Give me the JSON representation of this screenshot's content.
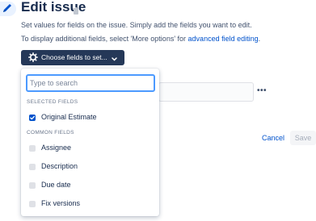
{
  "header": {
    "title": "Edit issue",
    "description": "Set values for fields on the issue. Simply add the fields you want to edit.",
    "more_text": "To display additional fields, select 'More options' for ",
    "more_link": "advanced field editing",
    "more_suffix": "."
  },
  "toolbar": {
    "choose_fields_label": "Choose fields to set..."
  },
  "dropdown": {
    "search_placeholder": "Type to search",
    "selected_heading": "SELECTED FIELDS",
    "selected_items": [
      {
        "label": "Original Estimate",
        "checked": true
      }
    ],
    "common_heading": "COMMON FIELDS",
    "common_items": [
      {
        "label": "Assignee",
        "checked": false
      },
      {
        "label": "Description",
        "checked": false
      },
      {
        "label": "Due date",
        "checked": false
      },
      {
        "label": "Fix versions",
        "checked": false
      }
    ]
  },
  "actions": {
    "cancel_label": "Cancel",
    "save_label": "Save"
  },
  "more_actions_label": "•••",
  "colors": {
    "primary": "#0052cc",
    "button_dark": "#253858",
    "focus_ring": "#4c9aff",
    "text": "#172b4d"
  }
}
